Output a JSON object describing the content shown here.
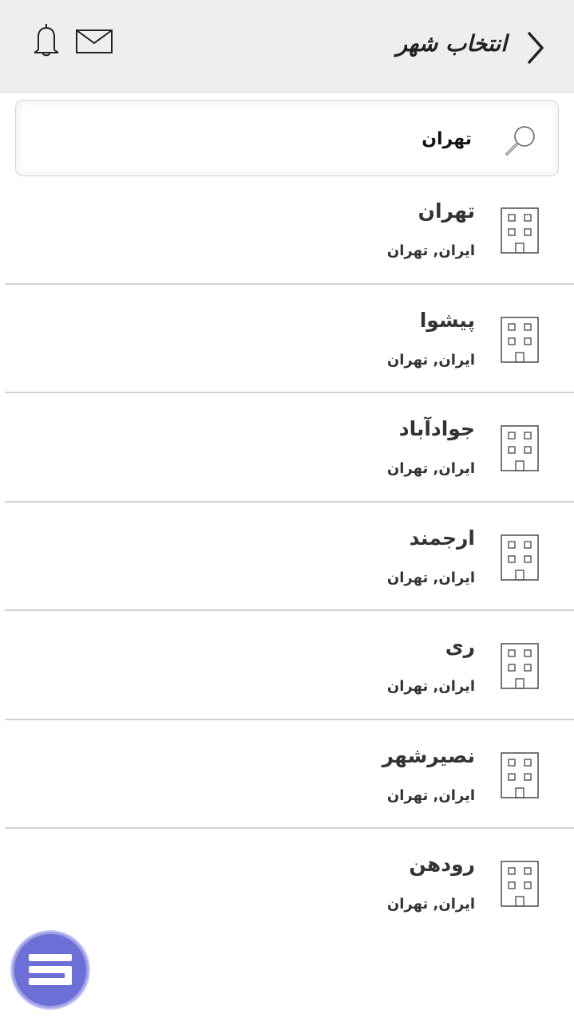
{
  "header": {
    "title": "انتخاب شهر"
  },
  "search": {
    "value": "تهران"
  },
  "results": [
    {
      "name": "تهران",
      "region": "ایران, تهران"
    },
    {
      "name": "پیشوا",
      "region": "ایران, تهران"
    },
    {
      "name": "جوادآباد",
      "region": "ایران, تهران"
    },
    {
      "name": "ارجمند",
      "region": "ایران, تهران"
    },
    {
      "name": "ری",
      "region": "ایران, تهران"
    },
    {
      "name": "نصیرشهر",
      "region": "ایران, تهران"
    },
    {
      "name": "رودهن",
      "region": "ایران, تهران"
    }
  ],
  "icons": {
    "back": "chevron-right-icon",
    "notifications": "bell-icon",
    "messages": "envelope-icon",
    "search": "magnifier-icon",
    "city": "building-icon",
    "fab": "menu-logo-icon"
  },
  "colors": {
    "header_bg": "#eeeeee",
    "fab": "#6b6fd6",
    "divider": "#d2d2d2"
  }
}
